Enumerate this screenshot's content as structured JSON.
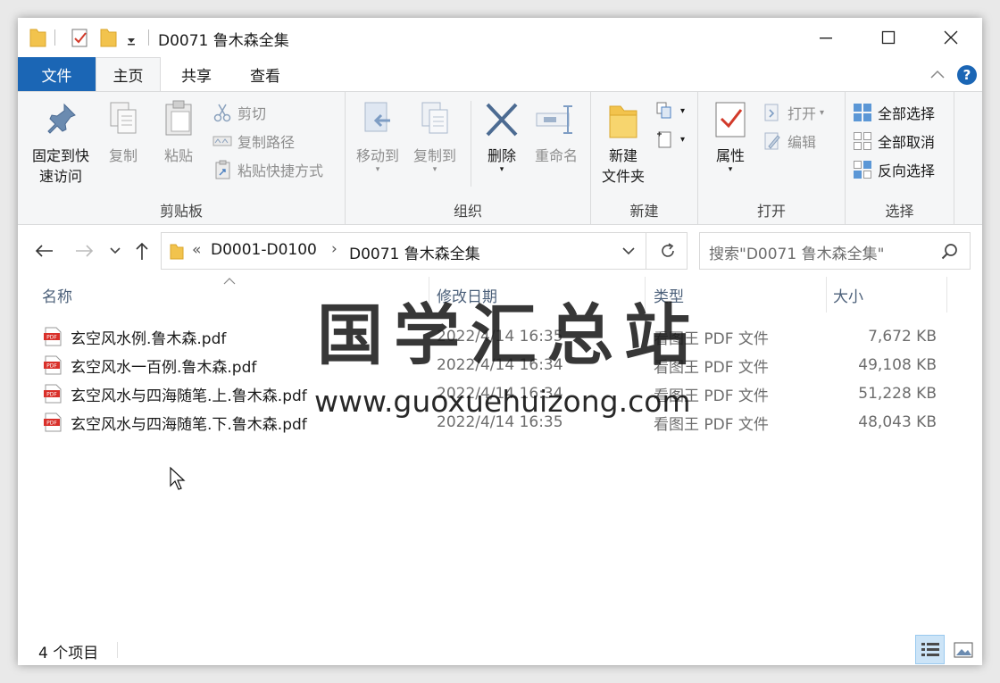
{
  "window": {
    "title": "D0071 鲁木森全集",
    "accent": "#1b66b5"
  },
  "ribbon_tabs": [
    {
      "label": "文件"
    },
    {
      "label": "主页"
    },
    {
      "label": "共享"
    },
    {
      "label": "查看"
    }
  ],
  "ribbon": {
    "clipboard": {
      "group_label": "剪贴板",
      "pin_label_1": "固定到快",
      "pin_label_2": "速访问",
      "copy_label": "复制",
      "paste_label": "粘贴",
      "cut_label": "剪切",
      "copy_path_label": "复制路径",
      "paste_shortcut_label": "粘贴快捷方式"
    },
    "organize": {
      "group_label": "组织",
      "move_to_label": "移动到",
      "copy_to_label": "复制到",
      "delete_label": "删除",
      "rename_label": "重命名"
    },
    "new": {
      "group_label": "新建",
      "new_folder_label_1": "新建",
      "new_folder_label_2": "文件夹"
    },
    "open": {
      "group_label": "打开",
      "properties_label": "属性",
      "open_label": "打开",
      "edit_label": "编辑"
    },
    "select": {
      "group_label": "选择",
      "select_all_label": "全部选择",
      "select_none_label": "全部取消",
      "invert_label": "反向选择"
    }
  },
  "address": {
    "prefix": "«",
    "crumbs": [
      "D0001-D0100",
      "D0071 鲁木森全集"
    ],
    "search_placeholder": "搜索\"D0071 鲁木森全集\""
  },
  "columns": {
    "name": "名称",
    "date": "修改日期",
    "type": "类型",
    "size": "大小"
  },
  "files": [
    {
      "name": "玄空风水例.鲁木森.pdf",
      "date": "2022/4/14 16:35",
      "type": "看图王 PDF 文件",
      "size": "7,672 KB"
    },
    {
      "name": "玄空风水一百例.鲁木森.pdf",
      "date": "2022/4/14 16:34",
      "type": "看图王 PDF 文件",
      "size": "49,108 KB"
    },
    {
      "name": "玄空风水与四海随笔.上.鲁木森.pdf",
      "date": "2022/4/14 16:34",
      "type": "看图王 PDF 文件",
      "size": "51,228 KB"
    },
    {
      "name": "玄空风水与四海随笔.下.鲁木森.pdf",
      "date": "2022/4/14 16:35",
      "type": "看图王 PDF 文件",
      "size": "48,043 KB"
    }
  ],
  "status": {
    "item_count": "4 个项目"
  },
  "watermark": {
    "title": "国学汇总站",
    "url": "www.guoxuehuizong.com"
  }
}
